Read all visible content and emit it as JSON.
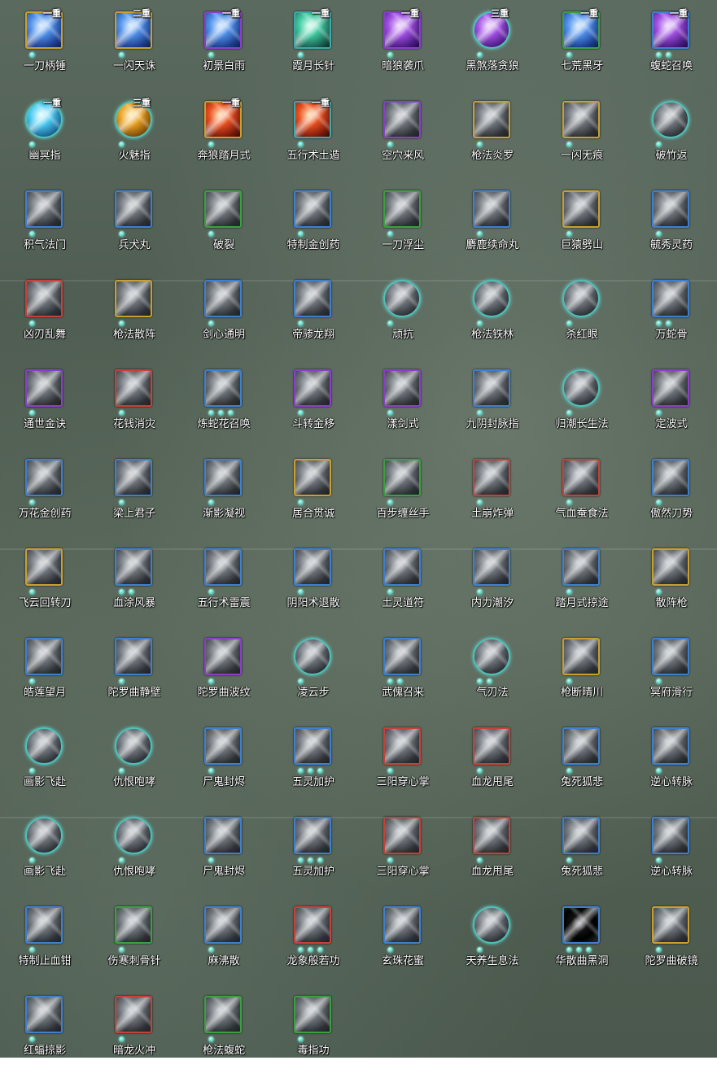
{
  "skills": [
    {
      "name": "一刀柄锤",
      "tier": "一重",
      "frame": "gold",
      "tint": "blue",
      "dots": 1
    },
    {
      "name": "一闪天诛",
      "tier": "二重",
      "frame": "gold",
      "tint": "blue",
      "dots": 1
    },
    {
      "name": "初景白雨",
      "tier": "一重",
      "frame": "purple",
      "tint": "blue",
      "dots": 1
    },
    {
      "name": "霞月长针",
      "tier": "一重",
      "frame": "teal",
      "tint": "teal",
      "dots": 1
    },
    {
      "name": "暗狼袭爪",
      "tier": "一重",
      "frame": "purple",
      "tint": "purple",
      "dots": 1
    },
    {
      "name": "黑煞落贪狼",
      "tier": "三重",
      "frame": "circle",
      "tint": "purple",
      "dots": 1,
      "glow": true
    },
    {
      "name": "七荒黑牙",
      "tier": "一重",
      "frame": "green",
      "tint": "blue",
      "dots": 1
    },
    {
      "name": "蝮蛇召唤",
      "tier": "一重",
      "frame": "blue",
      "tint": "purple",
      "dots": 2
    },
    {
      "name": "幽冥指",
      "tier": "一重",
      "frame": "circle",
      "tint": "cyan",
      "dots": 1,
      "glow": true
    },
    {
      "name": "火魅指",
      "tier": "三重",
      "frame": "circle",
      "tint": "gold",
      "dots": 1,
      "glow": true
    },
    {
      "name": "奔狼踏月式",
      "tier": "一重",
      "frame": "gold",
      "tint": "red",
      "dots": 1
    },
    {
      "name": "五行术土遁",
      "tier": "一重",
      "frame": "teal",
      "tint": "red",
      "dots": 1
    },
    {
      "name": "空穴来风",
      "tier": "",
      "frame": "purple",
      "tint": "grey",
      "dots": 1
    },
    {
      "name": "枪法炎罗",
      "tier": "",
      "frame": "gold",
      "tint": "grey",
      "dots": 1
    },
    {
      "name": "一闪无痕",
      "tier": "",
      "frame": "gold",
      "tint": "grey",
      "dots": 1
    },
    {
      "name": "破竹返",
      "tier": "",
      "frame": "circle",
      "tint": "grey",
      "dots": 1
    },
    {
      "name": "积气法门",
      "tier": "",
      "frame": "blue",
      "tint": "grey",
      "dots": 1
    },
    {
      "name": "兵犬丸",
      "tier": "",
      "frame": "blue",
      "tint": "grey",
      "dots": 1
    },
    {
      "name": "破裂",
      "tier": "",
      "frame": "green",
      "tint": "grey",
      "dots": 1
    },
    {
      "name": "特制金创药",
      "tier": "",
      "frame": "blue",
      "tint": "grey",
      "dots": 1
    },
    {
      "name": "一刀浮尘",
      "tier": "",
      "frame": "green",
      "tint": "grey",
      "dots": 1
    },
    {
      "name": "麝鹿续命丸",
      "tier": "",
      "frame": "blue",
      "tint": "grey",
      "dots": 1
    },
    {
      "name": "巨猿劈山",
      "tier": "",
      "frame": "gold",
      "tint": "grey",
      "dots": 1
    },
    {
      "name": "毓秀灵药",
      "tier": "",
      "frame": "blue",
      "tint": "grey",
      "dots": 1
    },
    {
      "name": "凶刃乱舞",
      "tier": "",
      "frame": "red",
      "tint": "grey",
      "dots": 1
    },
    {
      "name": "枪法散阵",
      "tier": "",
      "frame": "gold",
      "tint": "grey",
      "dots": 1
    },
    {
      "name": "剑心通明",
      "tier": "",
      "frame": "blue",
      "tint": "grey",
      "dots": 1
    },
    {
      "name": "帝骖龙翔",
      "tier": "",
      "frame": "blue",
      "tint": "grey",
      "dots": 1
    },
    {
      "name": "顽抗",
      "tier": "",
      "frame": "circle",
      "tint": "grey",
      "dots": 1
    },
    {
      "name": "枪法铁林",
      "tier": "",
      "frame": "circle",
      "tint": "grey",
      "dots": 1
    },
    {
      "name": "杀红眼",
      "tier": "",
      "frame": "circle",
      "tint": "grey",
      "dots": 1
    },
    {
      "name": "万蛇骨",
      "tier": "",
      "frame": "blue",
      "tint": "grey",
      "dots": 2
    },
    {
      "name": "通世金诀",
      "tier": "",
      "frame": "purple",
      "tint": "grey",
      "dots": 1
    },
    {
      "name": "花钱消灾",
      "tier": "",
      "frame": "red",
      "tint": "grey",
      "dots": 1
    },
    {
      "name": "炼蛇花召唤",
      "tier": "",
      "frame": "blue",
      "tint": "grey",
      "dots": 3
    },
    {
      "name": "斗转金移",
      "tier": "",
      "frame": "purple",
      "tint": "grey",
      "dots": 1
    },
    {
      "name": "漾剑式",
      "tier": "",
      "frame": "purple",
      "tint": "grey",
      "dots": 1
    },
    {
      "name": "九阴封脉指",
      "tier": "",
      "frame": "blue",
      "tint": "grey",
      "dots": 1
    },
    {
      "name": "归潮长生法",
      "tier": "",
      "frame": "circle",
      "tint": "grey",
      "dots": 1
    },
    {
      "name": "定波式",
      "tier": "",
      "frame": "purple",
      "tint": "grey",
      "dots": 1
    },
    {
      "name": "万花金创药",
      "tier": "",
      "frame": "blue",
      "tint": "grey",
      "dots": 1
    },
    {
      "name": "梁上君子",
      "tier": "",
      "frame": "blue",
      "tint": "grey",
      "dots": 1
    },
    {
      "name": "渐影凝视",
      "tier": "",
      "frame": "blue",
      "tint": "grey",
      "dots": 1
    },
    {
      "name": "居合贯诚",
      "tier": "",
      "frame": "gold",
      "tint": "grey",
      "dots": 1
    },
    {
      "name": "百步缠丝手",
      "tier": "",
      "frame": "green",
      "tint": "grey",
      "dots": 1
    },
    {
      "name": "土崩炸弹",
      "tier": "",
      "frame": "red",
      "tint": "grey",
      "dots": 1
    },
    {
      "name": "气血蚕食法",
      "tier": "",
      "frame": "red",
      "tint": "grey",
      "dots": 1
    },
    {
      "name": "傲然刀势",
      "tier": "",
      "frame": "blue",
      "tint": "grey",
      "dots": 1
    },
    {
      "name": "飞云回转刀",
      "tier": "",
      "frame": "gold",
      "tint": "grey",
      "dots": 1
    },
    {
      "name": "血涂风暴",
      "tier": "",
      "frame": "blue",
      "tint": "grey",
      "dots": 2
    },
    {
      "name": "五行术雷震",
      "tier": "",
      "frame": "blue",
      "tint": "grey",
      "dots": 1
    },
    {
      "name": "阴阳术退散",
      "tier": "",
      "frame": "blue",
      "tint": "grey",
      "dots": 1
    },
    {
      "name": "土灵道符",
      "tier": "",
      "frame": "blue",
      "tint": "grey",
      "dots": 1
    },
    {
      "name": "内力潮汐",
      "tier": "",
      "frame": "blue",
      "tint": "grey",
      "dots": 1
    },
    {
      "name": "踏月式掠途",
      "tier": "",
      "frame": "blue",
      "tint": "grey",
      "dots": 1
    },
    {
      "name": "散阵枪",
      "tier": "",
      "frame": "gold",
      "tint": "grey",
      "dots": 1
    },
    {
      "name": "皓莲望月",
      "tier": "",
      "frame": "blue",
      "tint": "grey",
      "dots": 1
    },
    {
      "name": "陀罗曲静壁",
      "tier": "",
      "frame": "blue",
      "tint": "grey",
      "dots": 1
    },
    {
      "name": "陀罗曲波纹",
      "tier": "",
      "frame": "purple",
      "tint": "grey",
      "dots": 1
    },
    {
      "name": "凌云步",
      "tier": "",
      "frame": "circle",
      "tint": "grey",
      "dots": 1
    },
    {
      "name": "武傀召来",
      "tier": "",
      "frame": "blue",
      "tint": "grey",
      "dots": 2
    },
    {
      "name": "气刃法",
      "tier": "",
      "frame": "circle",
      "tint": "grey",
      "dots": 2
    },
    {
      "name": "枪断晴川",
      "tier": "",
      "frame": "gold",
      "tint": "grey",
      "dots": 1
    },
    {
      "name": "冥府滑行",
      "tier": "",
      "frame": "blue",
      "tint": "grey",
      "dots": 1
    },
    {
      "name": "画影飞赴",
      "tier": "",
      "frame": "circle",
      "tint": "grey",
      "dots": 1
    },
    {
      "name": "仇恨咆哮",
      "tier": "",
      "frame": "circle",
      "tint": "grey",
      "dots": 1
    },
    {
      "name": "尸鬼封烬",
      "tier": "",
      "frame": "blue",
      "tint": "grey",
      "dots": 1
    },
    {
      "name": "五灵加护",
      "tier": "",
      "frame": "blue",
      "tint": "grey",
      "dots": 3
    },
    {
      "name": "三阳穿心掌",
      "tier": "",
      "frame": "red",
      "tint": "grey",
      "dots": 1
    },
    {
      "name": "血龙甩尾",
      "tier": "",
      "frame": "red",
      "tint": "grey",
      "dots": 1
    },
    {
      "name": "兔死狐悲",
      "tier": "",
      "frame": "blue",
      "tint": "grey",
      "dots": 1
    },
    {
      "name": "逆心转脉",
      "tier": "",
      "frame": "blue",
      "tint": "grey",
      "dots": 1
    },
    {
      "name": "画影飞赴",
      "tier": "",
      "frame": "circle",
      "tint": "grey",
      "dots": 1
    },
    {
      "name": "仇恨咆哮",
      "tier": "",
      "frame": "circle",
      "tint": "grey",
      "dots": 1
    },
    {
      "name": "尸鬼封烬",
      "tier": "",
      "frame": "blue",
      "tint": "grey",
      "dots": 1
    },
    {
      "name": "五灵加护",
      "tier": "",
      "frame": "blue",
      "tint": "grey",
      "dots": 3
    },
    {
      "name": "三阳穿心掌",
      "tier": "",
      "frame": "red",
      "tint": "grey",
      "dots": 1
    },
    {
      "name": "血龙甩尾",
      "tier": "",
      "frame": "red",
      "tint": "grey",
      "dots": 1
    },
    {
      "name": "兔死狐悲",
      "tier": "",
      "frame": "blue",
      "tint": "grey",
      "dots": 1
    },
    {
      "name": "逆心转脉",
      "tier": "",
      "frame": "blue",
      "tint": "grey",
      "dots": 1
    },
    {
      "name": "特制止血钳",
      "tier": "",
      "frame": "blue",
      "tint": "grey",
      "dots": 1
    },
    {
      "name": "伤寒刺骨针",
      "tier": "",
      "frame": "green",
      "tint": "grey",
      "dots": 1
    },
    {
      "name": "麻沸散",
      "tier": "",
      "frame": "blue",
      "tint": "grey",
      "dots": 1
    },
    {
      "name": "龙象般若功",
      "tier": "",
      "frame": "red",
      "tint": "grey",
      "dots": 3
    },
    {
      "name": "玄珠花蜜",
      "tier": "",
      "frame": "blue",
      "tint": "grey",
      "dots": 1
    },
    {
      "name": "天养生息法",
      "tier": "",
      "frame": "circle",
      "tint": "grey",
      "dots": 1
    },
    {
      "name": "华散曲黑洞",
      "tier": "",
      "frame": "blue",
      "tint": "dark",
      "dots": 3
    },
    {
      "name": "陀罗曲破镜",
      "tier": "",
      "frame": "gold",
      "tint": "grey",
      "dots": 1
    },
    {
      "name": "红蝠掠影",
      "tier": "",
      "frame": "blue",
      "tint": "grey",
      "dots": 1
    },
    {
      "name": "暗龙火冲",
      "tier": "",
      "frame": "red",
      "tint": "grey",
      "dots": 1
    },
    {
      "name": "枪法蝮蛇",
      "tier": "",
      "frame": "green",
      "tint": "grey",
      "dots": 1
    },
    {
      "name": "毒指功",
      "tier": "",
      "frame": "green",
      "tint": "grey",
      "dots": 1
    }
  ],
  "colors": {
    "dot": "#6ed8c8",
    "frame_gold": "#c8a030",
    "frame_blue": "#3e7fd0",
    "frame_purple": "#8a3fc8",
    "frame_green": "#3aa040",
    "frame_red": "#c8403a",
    "frame_teal": "#3fa8a8",
    "frame_circle": "#4fc0b8"
  }
}
